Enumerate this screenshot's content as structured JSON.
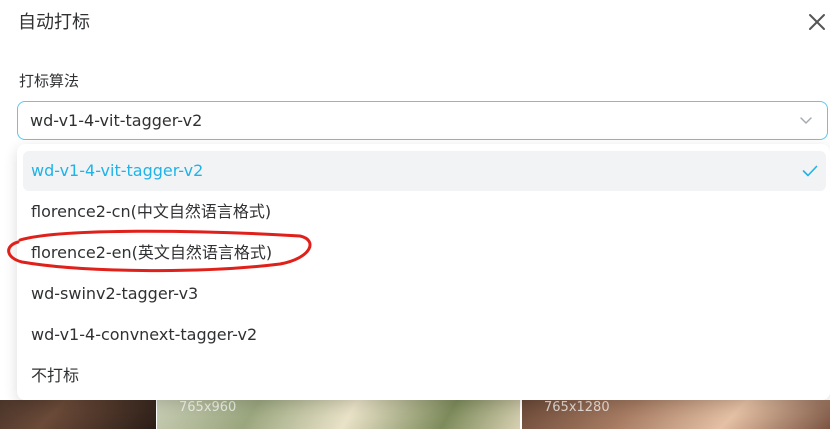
{
  "dialog": {
    "title": "自动打标",
    "close_icon": "close-icon"
  },
  "form": {
    "label": "打标算法",
    "selected_value": "wd-v1-4-vit-tagger-v2",
    "chevron_icon": "chevron-down-icon"
  },
  "dropdown": {
    "options": [
      {
        "label": "wd-v1-4-vit-tagger-v2",
        "selected": true
      },
      {
        "label": "florence2-cn(中文自然语言格式)",
        "selected": false
      },
      {
        "label": "florence2-en(英文自然语言格式)",
        "selected": false,
        "annotated": true
      },
      {
        "label": "wd-swinv2-tagger-v3",
        "selected": false
      },
      {
        "label": "wd-v1-4-convnext-tagger-v2",
        "selected": false
      },
      {
        "label": "不打标",
        "selected": false
      }
    ],
    "check_icon": "check-icon"
  },
  "background": {
    "thumbnails": [
      {
        "size": ""
      },
      {
        "size": "765x960"
      },
      {
        "size": "765x1280"
      }
    ]
  },
  "colors": {
    "accent": "#1fb3e8",
    "input_border": "#5ac8f0",
    "selected_bg": "#f2f3f5",
    "annotation": "#e0201a"
  }
}
